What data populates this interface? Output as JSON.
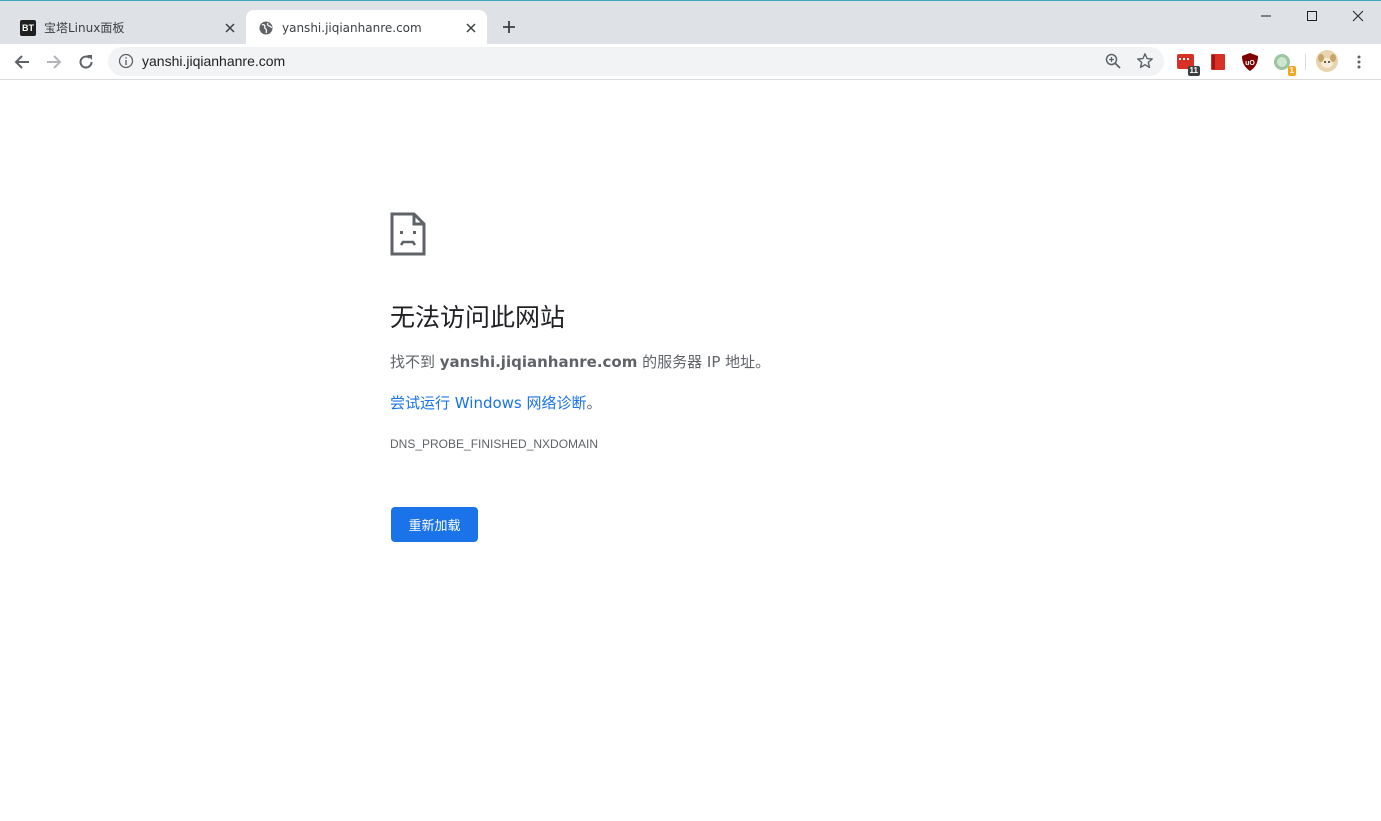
{
  "tabs": [
    {
      "favicon": "bt-logo-icon",
      "favicon_text": "BT",
      "title": "宝塔Linux面板"
    },
    {
      "favicon": "globe-icon",
      "title": "yanshi.jiqianhanre.com"
    }
  ],
  "toolbar": {
    "url": "yanshi.jiqianhanre.com",
    "extensions": [
      {
        "icon": "calendar-extension-icon",
        "badge": "11",
        "color": "#d93025"
      },
      {
        "icon": "book-extension-icon",
        "color": "#d93025"
      },
      {
        "icon": "ublock-shield-icon",
        "color": "#800000"
      },
      {
        "icon": "globe-extension-icon",
        "badge": "1",
        "color": "#f5a623"
      }
    ]
  },
  "error_page": {
    "title": "无法访问此网站",
    "desc_prefix": "找不到 ",
    "desc_host": "yanshi.jiqianhanre.com",
    "desc_suffix": " 的服务器 IP 地址。",
    "link_text": "尝试运行 Windows 网络诊断",
    "link_suffix": "。",
    "error_code": "DNS_PROBE_FINISHED_NXDOMAIN",
    "reload_label": "重新加载"
  },
  "colors": {
    "accent": "#1a73e8",
    "tabstrip": "#dee1e6",
    "omnibox": "#f1f3f4"
  }
}
